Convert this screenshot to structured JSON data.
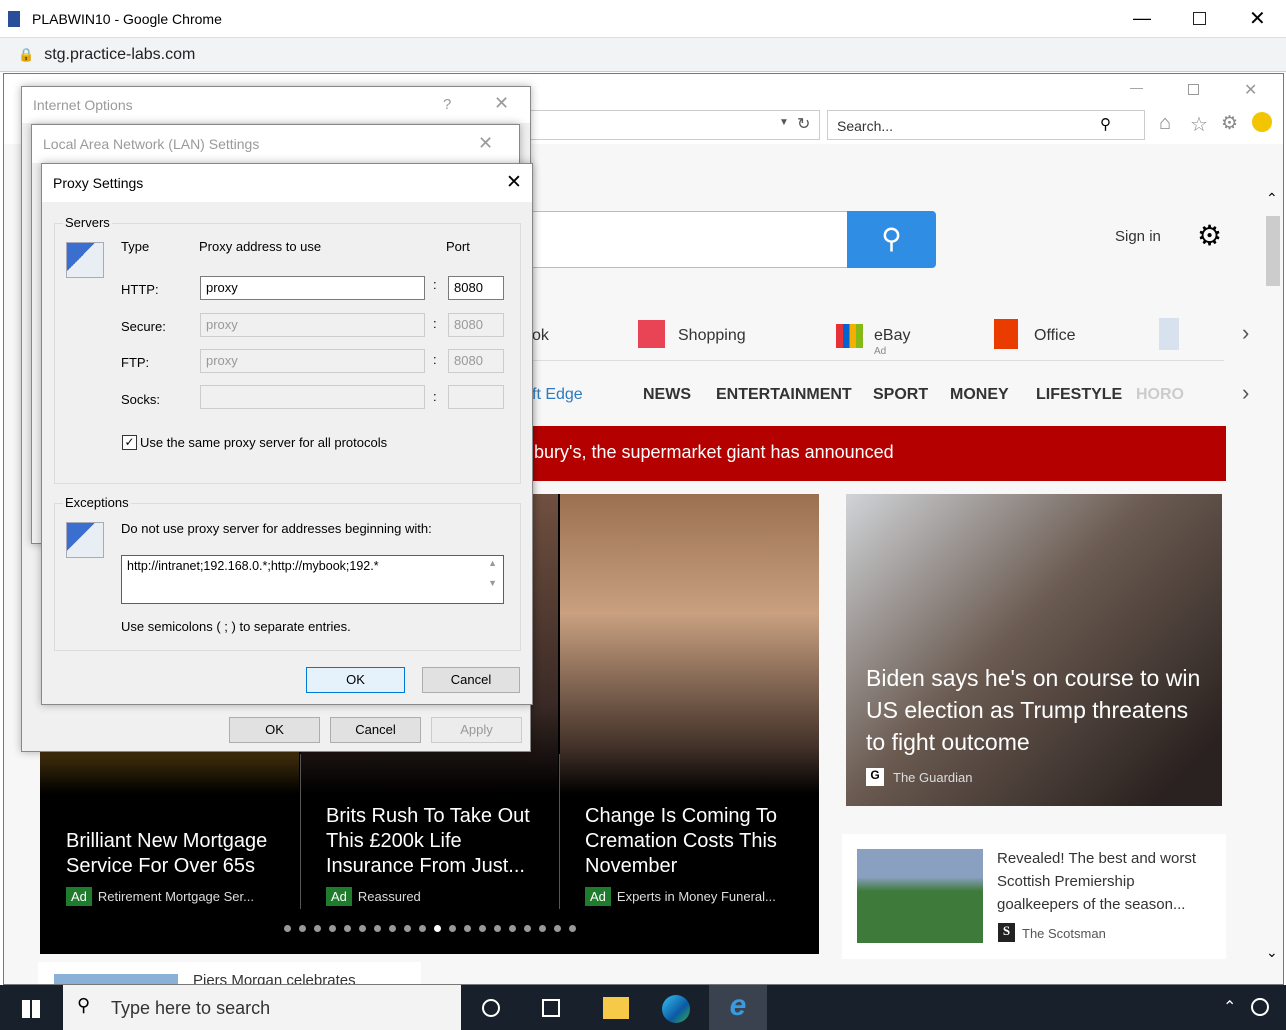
{
  "chrome": {
    "title": "PLABWIN10 - Google Chrome",
    "url": "stg.practice-labs.com"
  },
  "ie": {
    "search_placeholder": "Search...",
    "sign_in": "Sign in",
    "quicklinks": [
      {
        "label": "ok"
      },
      {
        "label": "Shopping"
      },
      {
        "label": "eBay",
        "sub": "Ad"
      },
      {
        "label": "Office"
      }
    ],
    "nav": {
      "edge": "ft Edge",
      "items": [
        "NEWS",
        "ENTERTAINMENT",
        "SPORT",
        "MONEY",
        "LIFESTYLE",
        "HORO"
      ]
    },
    "breaking": "bury's, the supermarket giant has announced",
    "carousel": [
      {
        "title": "Brilliant New Mortgage Service For Over 65s",
        "badge": "Ad",
        "source": "Retirement Mortgage Ser..."
      },
      {
        "title": "Brits Rush To Take Out This £200k Life Insurance From Just...",
        "badge": "Ad",
        "source": "Reassured"
      },
      {
        "title": "Change Is Coming To Cremation Costs This November",
        "badge": "Ad",
        "source": "Experts in Money Funeral..."
      }
    ],
    "carousel_pages": 20,
    "carousel_active": 11,
    "hero": {
      "title": "Biden says he's on course to win US election as Trump threatens to fight outcome",
      "source": "The Guardian"
    },
    "side_card": {
      "title": "Revealed! The best and worst Scottish Premiership goalkeepers of the season...",
      "source": "The Scotsman"
    },
    "bottom_card": {
      "title": "Piers Morgan celebrates"
    }
  },
  "internet_options": {
    "title": "Internet Options",
    "help": "?",
    "ok": "OK",
    "cancel": "Cancel",
    "apply": "Apply"
  },
  "lan": {
    "title": "Local Area Network (LAN) Settings"
  },
  "proxy": {
    "title": "Proxy Settings",
    "servers_label": "Servers",
    "col_type": "Type",
    "col_address": "Proxy address to use",
    "col_port": "Port",
    "rows": [
      {
        "type": "HTTP:",
        "address": "proxy",
        "port": "8080",
        "enabled": true
      },
      {
        "type": "Secure:",
        "address": "proxy",
        "port": "8080",
        "enabled": false
      },
      {
        "type": "FTP:",
        "address": "proxy",
        "port": "8080",
        "enabled": false
      },
      {
        "type": "Socks:",
        "address": "",
        "port": "",
        "enabled": false
      }
    ],
    "same_proxy": "Use the same proxy server for all protocols",
    "same_proxy_checked": true,
    "exceptions_label": "Exceptions",
    "exceptions_desc": "Do not use proxy server for addresses beginning with:",
    "exceptions_value": "http://intranet;192.168.0.*;http://mybook;192.*",
    "exceptions_hint": "Use semicolons ( ; ) to separate entries.",
    "ok": "OK",
    "cancel": "Cancel"
  },
  "taskbar": {
    "search_placeholder": "Type here to search"
  }
}
